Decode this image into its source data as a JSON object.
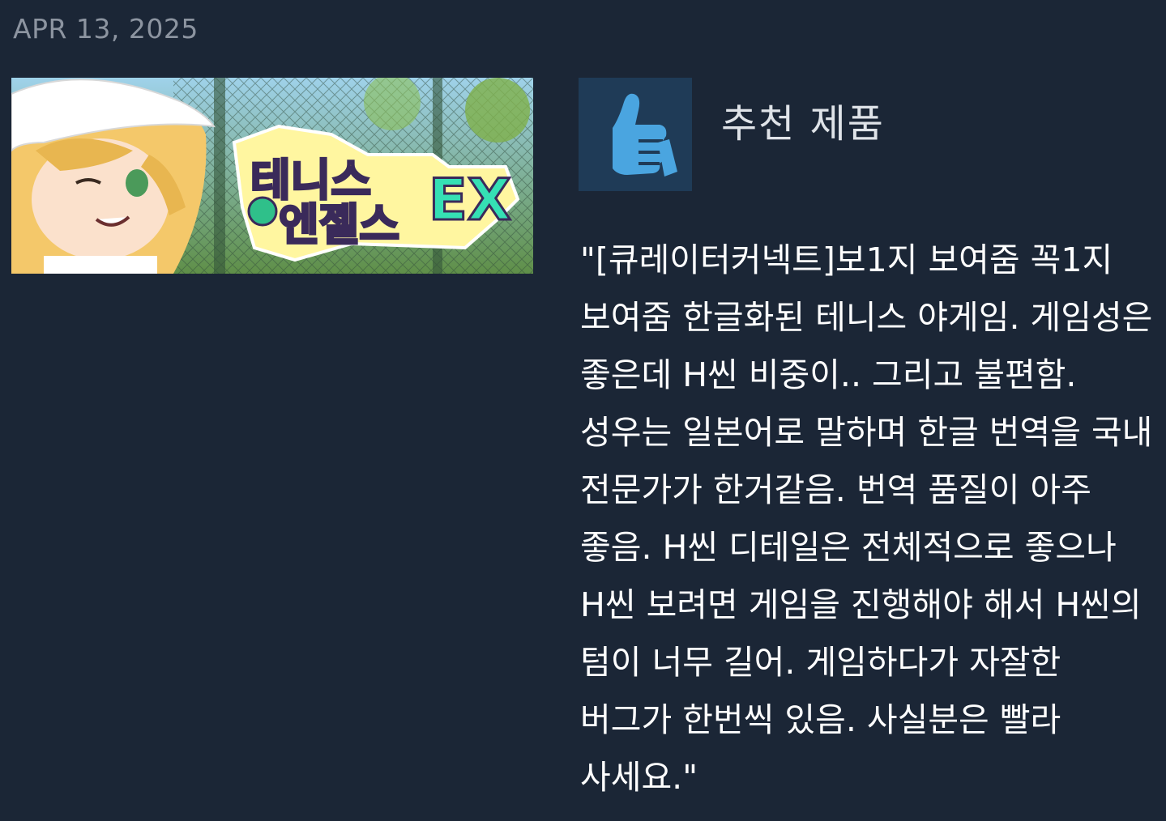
{
  "review": {
    "date": "APR 13, 2025",
    "recommendation": {
      "icon": "thumbs-up-icon",
      "label": "추천 제품"
    },
    "text": "\"[큐레이터커넥트]보1지 보여줌 꼭1지 보여줌 한글화된 테니스 야게임. 게임성은 좋은데 H씬 비중이.. 그리고 불편함. 성우는 일본어로 말하며 한글 번역을 국내 전문가가 한거같음. 번역 품질이 아주 좋음. H씬 디테일은 전체적으로 좋으나 H씬 보려면 게임을 진행해야 해서 H씬의 텀이 너무 길어. 게임하다가 자잘한 버그가 한번씩 있음. 사실분은 빨라 사세요.\""
  },
  "game": {
    "capsule_logo_lines": [
      "테니스",
      "엔젤스",
      "EX"
    ]
  },
  "colors": {
    "background": "#1b2636",
    "date": "#8c94a0",
    "icon_bg": "#1f3b57",
    "thumb": "#4aa5e0",
    "text": "#ffffff"
  }
}
